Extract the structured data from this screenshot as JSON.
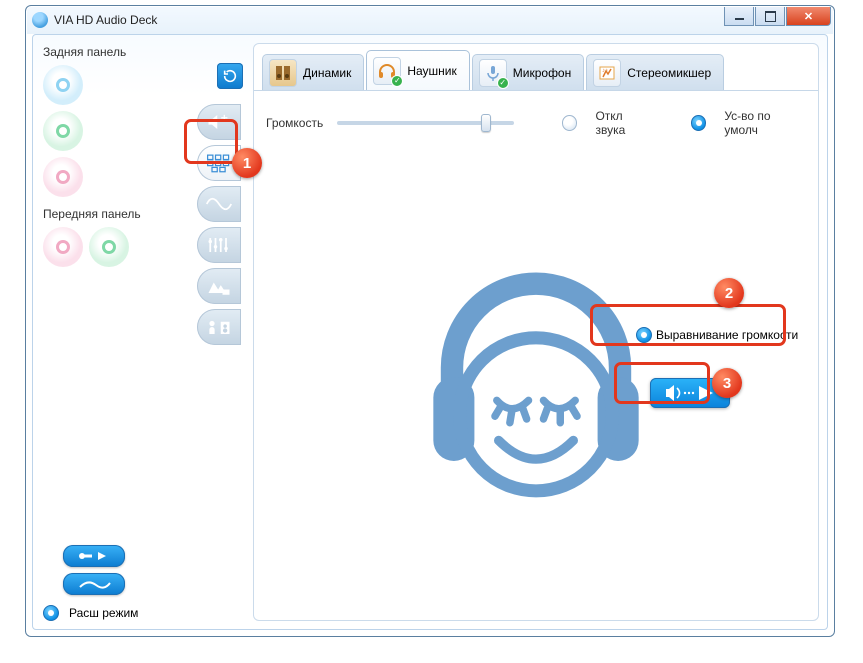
{
  "window_title": "VIA HD Audio Deck",
  "sidebar": {
    "rear_panel_label": "Задняя панель",
    "front_panel_label": "Передняя панель",
    "rear_jacks": [
      {
        "color": "#8fd3f2"
      },
      {
        "color": "#b8ebc9"
      },
      {
        "color": "#f5c6d6"
      }
    ],
    "front_jacks": [
      {
        "color": "#f5c6d6"
      },
      {
        "color": "#b8ebc9"
      }
    ],
    "advanced_mode_label": "Расш режим"
  },
  "vtabs": [
    {
      "name": "volume-boost",
      "active": false
    },
    {
      "name": "level-calib",
      "active": true
    },
    {
      "name": "sine",
      "active": false
    },
    {
      "name": "equalizer",
      "active": false
    },
    {
      "name": "environment",
      "active": false
    },
    {
      "name": "room-corr",
      "active": false
    }
  ],
  "device_tabs": [
    {
      "name": "speaker",
      "label": "Динамик",
      "active": false,
      "badge": false
    },
    {
      "name": "headphone",
      "label": "Наушник",
      "active": true,
      "badge": true
    },
    {
      "name": "microphone",
      "label": "Микрофон",
      "active": false,
      "badge": true
    },
    {
      "name": "stereomix",
      "label": "Стереомикшер",
      "active": false,
      "badge": false
    }
  ],
  "main": {
    "volume_label": "Громкость",
    "mute_label": "Откл звука",
    "default_device_label": "Ус-во по умолч",
    "default_device_on": true,
    "loudness_equal_label": "Выравнивание громкости",
    "loudness_equal_on": true,
    "slider_percent": 80
  },
  "annotations": {
    "n1": "1",
    "n2": "2",
    "n3": "3"
  },
  "colors": {
    "illus": "#6d9fce",
    "accent": "#0d8fe5",
    "anno": "#e2371d"
  }
}
